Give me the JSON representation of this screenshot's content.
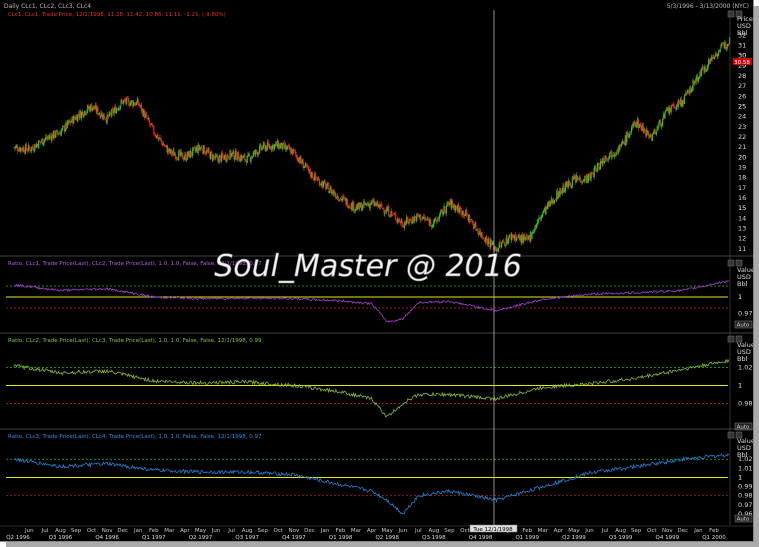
{
  "header": {
    "title": "Daily CLc1, CLc2, CLc3, CLc4",
    "date_range": "5/3/1996 - 3/13/2000 (NYC)"
  },
  "watermark": "Soul_Master @ 2016",
  "colors": {
    "background": "#000000",
    "up_candle": "#22cc22",
    "down_candle": "#ee2222",
    "ratio_1_2": "#a040d0",
    "ratio_2_3": "#88b830",
    "ratio_3_4": "#2080d0",
    "parity_line": "#e8e800",
    "upper_band": "#20c020",
    "lower_band": "#d02020"
  },
  "panels": [
    {
      "legend": "CLc1, CLc1, Trade Price, 12/1/1998, 11.28, 11.42, 10.86, 11.11, -1.21, (-9.80%)",
      "axis_title": [
        "Price",
        "USD",
        "Bbl"
      ],
      "last_value": "30.58"
    },
    {
      "legend": "Ratio, CLc1, Trade Price(Last), CLc2, Trade Price(Last), 1.0, 1.0, False, False, 12/1/1998, 0.97",
      "axis_title": [
        "Value",
        "USD",
        "Bbl"
      ],
      "auto_label": "Auto"
    },
    {
      "legend": "Ratio, CLc2, Trade Price(Last), CLc3, Trade Price(Last), 1.0, 1.0, False, False, 12/1/1998, 0.99",
      "axis_title": [
        "Value",
        "USD",
        "Bbl"
      ],
      "auto_label": "Auto"
    },
    {
      "legend": "Ratio, CLc3, Trade Price(Last), CLc4, Trade Price(Last), 1.0, 1.0, False, False, 12/1/1998, 0.97",
      "axis_title": [
        "Value",
        "USD",
        "Bbl"
      ],
      "auto_label": "Auto"
    }
  ],
  "xaxis": {
    "months": [
      "Jun",
      "Jul",
      "Aug",
      "Sep",
      "Oct",
      "Nov",
      "Dec",
      "Jan",
      "Feb",
      "Mar",
      "Apr",
      "May",
      "Jun",
      "Jul",
      "Aug",
      "Sep",
      "Oct",
      "Nov",
      "Dec",
      "Jan",
      "Feb",
      "Mar",
      "Apr",
      "May",
      "Jun",
      "Jul",
      "Aug",
      "Sep",
      "Oct",
      "Nov",
      "Dec",
      "Jan",
      "Feb",
      "Mar",
      "Apr",
      "May",
      "Jun",
      "Jul",
      "Aug",
      "Sep",
      "Oct",
      "Nov",
      "Dec",
      "Jan",
      "Feb",
      "Mar"
    ],
    "quarters": [
      "Q2 1996",
      "Q3 1996",
      "Q4 1996",
      "Q1 1997",
      "Q2 1997",
      "Q3 1997",
      "Q4 1997",
      "Q1 1998",
      "Q2 1998",
      "Q3 1998",
      "Q4 1998",
      "Q1 1999",
      "Q2 1999",
      "Q3 1999",
      "Q4 1999",
      "Q1 2000"
    ],
    "cursor_date": "Tue 12/1/1998"
  },
  "chart_data": [
    {
      "type": "candlestick",
      "title": "CLc1 Daily",
      "yticks": [
        11,
        12,
        13,
        14,
        15,
        16,
        17,
        18,
        19,
        20,
        21,
        22,
        23,
        24,
        25,
        26,
        27,
        28,
        29,
        30,
        31,
        32
      ],
      "ylim": [
        10.5,
        33.5
      ],
      "x": [
        "1996-05",
        "1996-06",
        "1996-07",
        "1996-08",
        "1996-09",
        "1996-10",
        "1996-11",
        "1996-12",
        "1997-01",
        "1997-02",
        "1997-03",
        "1997-04",
        "1997-05",
        "1997-06",
        "1997-07",
        "1997-08",
        "1997-09",
        "1997-10",
        "1997-11",
        "1997-12",
        "1998-01",
        "1998-02",
        "1998-03",
        "1998-04",
        "1998-05",
        "1998-06",
        "1998-07",
        "1998-08",
        "1998-09",
        "1998-10",
        "1998-11",
        "1998-12",
        "1999-01",
        "1999-02",
        "1999-03",
        "1999-04",
        "1999-05",
        "1999-06",
        "1999-07",
        "1999-08",
        "1999-09",
        "1999-10",
        "1999-11",
        "1999-12",
        "2000-01",
        "2000-02",
        "2000-03"
      ],
      "close": [
        21.0,
        20.8,
        21.8,
        22.5,
        24.0,
        25.0,
        23.8,
        25.5,
        25.3,
        22.5,
        20.5,
        20.0,
        21.0,
        19.8,
        20.3,
        19.8,
        21.0,
        21.2,
        20.5,
        18.5,
        17.2,
        16.0,
        15.0,
        15.5,
        14.8,
        13.5,
        14.2,
        13.5,
        15.5,
        14.5,
        12.5,
        11.0,
        12.3,
        11.8,
        14.5,
        16.5,
        17.8,
        18.0,
        20.0,
        21.0,
        23.5,
        22.0,
        24.5,
        25.5,
        28.0,
        30.0,
        31.5
      ]
    },
    {
      "type": "line",
      "title": "Ratio CLc1 / CLc2",
      "yticks": [
        1,
        0.97
      ],
      "band": {
        "upper": 1.02,
        "parity": 1.0,
        "lower": 0.98
      },
      "ylim": [
        0.94,
        1.04
      ],
      "x": [
        "1996-05",
        "1996-08",
        "1996-11",
        "1997-02",
        "1997-05",
        "1997-08",
        "1997-11",
        "1998-02",
        "1998-04",
        "1998-05",
        "1998-06",
        "1998-07",
        "1998-09",
        "1998-12",
        "1999-03",
        "1999-06",
        "1999-09",
        "1999-12",
        "2000-03"
      ],
      "values": [
        1.022,
        1.012,
        1.015,
        1.0,
        0.997,
        0.998,
        0.997,
        0.993,
        0.988,
        0.955,
        0.96,
        0.99,
        0.992,
        0.975,
        0.996,
        1.005,
        1.008,
        1.012,
        1.03
      ]
    },
    {
      "type": "line",
      "title": "Ratio CLc2 / CLc3",
      "yticks": [
        1.02,
        1,
        0.98
      ],
      "band": {
        "upper": 1.02,
        "parity": 1.0,
        "lower": 0.98
      },
      "ylim": [
        0.955,
        1.045
      ],
      "x": [
        "1996-05",
        "1996-08",
        "1996-11",
        "1997-02",
        "1997-05",
        "1997-08",
        "1997-11",
        "1998-02",
        "1998-04",
        "1998-05",
        "1998-06",
        "1998-07",
        "1998-09",
        "1998-12",
        "1999-03",
        "1999-06",
        "1999-09",
        "1999-12",
        "2000-03"
      ],
      "values": [
        1.022,
        1.014,
        1.016,
        1.005,
        1.003,
        1.004,
        1.0,
        0.993,
        0.985,
        0.965,
        0.98,
        0.99,
        0.99,
        0.985,
        0.998,
        1.002,
        1.008,
        1.018,
        1.028
      ]
    },
    {
      "type": "line",
      "title": "Ratio CLc3 / CLc4",
      "yticks": [
        1.02,
        1.01,
        1,
        0.99,
        0.98,
        0.97,
        0.96
      ],
      "band": {
        "upper": 1.02,
        "parity": 1.0,
        "lower": 0.98
      },
      "ylim": [
        0.95,
        1.04
      ],
      "x": [
        "1996-05",
        "1996-08",
        "1996-11",
        "1997-02",
        "1997-05",
        "1997-08",
        "1997-11",
        "1998-02",
        "1998-04",
        "1998-05",
        "1998-06",
        "1998-07",
        "1998-09",
        "1998-12",
        "1999-03",
        "1999-06",
        "1999-09",
        "1999-12",
        "2000-03"
      ],
      "values": [
        1.02,
        1.012,
        1.015,
        1.008,
        1.006,
        1.006,
        1.003,
        0.992,
        0.985,
        0.975,
        0.96,
        0.98,
        0.985,
        0.975,
        0.99,
        1.005,
        1.012,
        1.02,
        1.025
      ]
    }
  ]
}
